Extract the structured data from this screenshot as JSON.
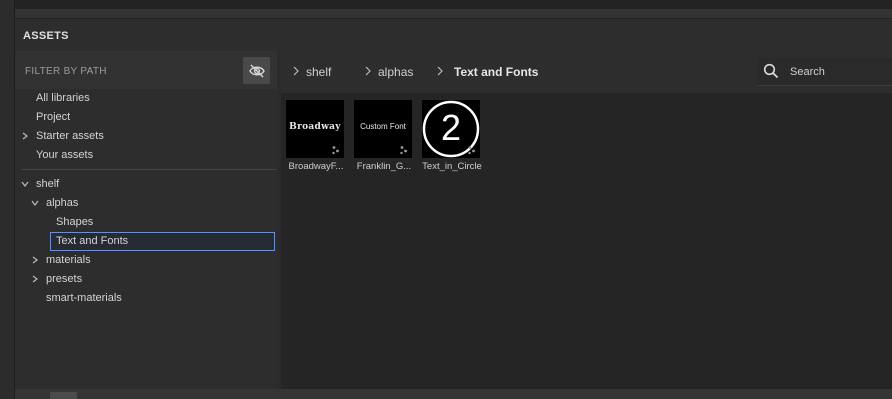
{
  "panel": {
    "title": "ASSETS"
  },
  "filter": {
    "label": "FILTER BY PATH",
    "toggle_icon": "eye-off-icon"
  },
  "tree": {
    "libraries": [
      {
        "label": "All libraries",
        "expandable": false
      },
      {
        "label": "Project",
        "expandable": false
      },
      {
        "label": "Starter assets",
        "expandable": true
      },
      {
        "label": "Your assets",
        "expandable": false
      }
    ],
    "shelf": {
      "label": "shelf",
      "children": {
        "alphas": {
          "label": "alphas",
          "children": [
            "Shapes",
            "Text and Fonts"
          ]
        },
        "materials": "materials",
        "presets": "presets",
        "smart_materials": "smart-materials"
      }
    },
    "selected": "Text and Fonts"
  },
  "breadcrumb": [
    "shelf",
    "alphas",
    "Text and Fonts"
  ],
  "search": {
    "placeholder": "Search"
  },
  "assets": [
    {
      "name": "BroadwayF...",
      "preview_text": "Broadway"
    },
    {
      "name": "Franklin_G...",
      "preview_text": "Custom Font"
    },
    {
      "name": "Text_in_Circle",
      "preview_text": "2"
    }
  ],
  "colors": {
    "selection_border": "#6d8fd0",
    "background": "#2b2b2b"
  }
}
